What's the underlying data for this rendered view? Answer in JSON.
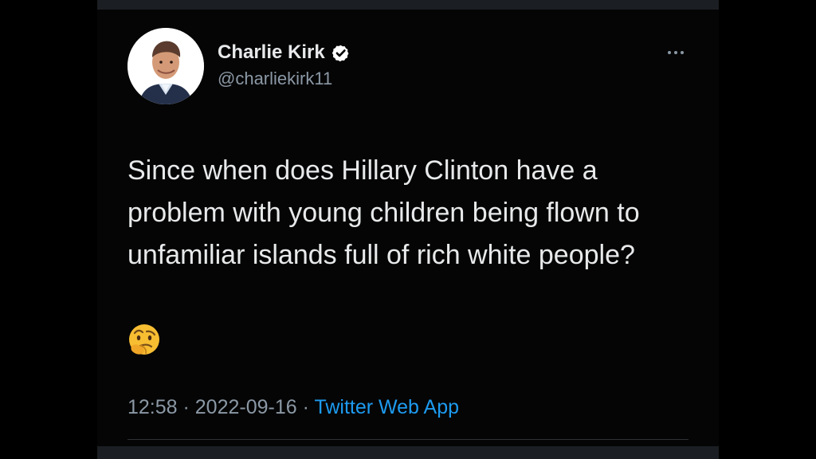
{
  "tweet": {
    "author_name": "Charlie Kirk",
    "handle": "@charliekirk11",
    "verified_icon": "verified-badge-icon",
    "more_icon": "more-options-icon",
    "text": "Since when does Hillary Clinton have a problem with young children being flown to unfamiliar islands full of rich white people?",
    "emoji": "🤔",
    "time": "12:58",
    "separator": " · ",
    "date": "2022-09-16",
    "source": "Twitter Web App"
  },
  "colors": {
    "background": "#000000",
    "card": "#050505",
    "primary_text": "#e7e9ea",
    "secondary_text": "#8b98a5",
    "accent": "#1d9bf0"
  }
}
